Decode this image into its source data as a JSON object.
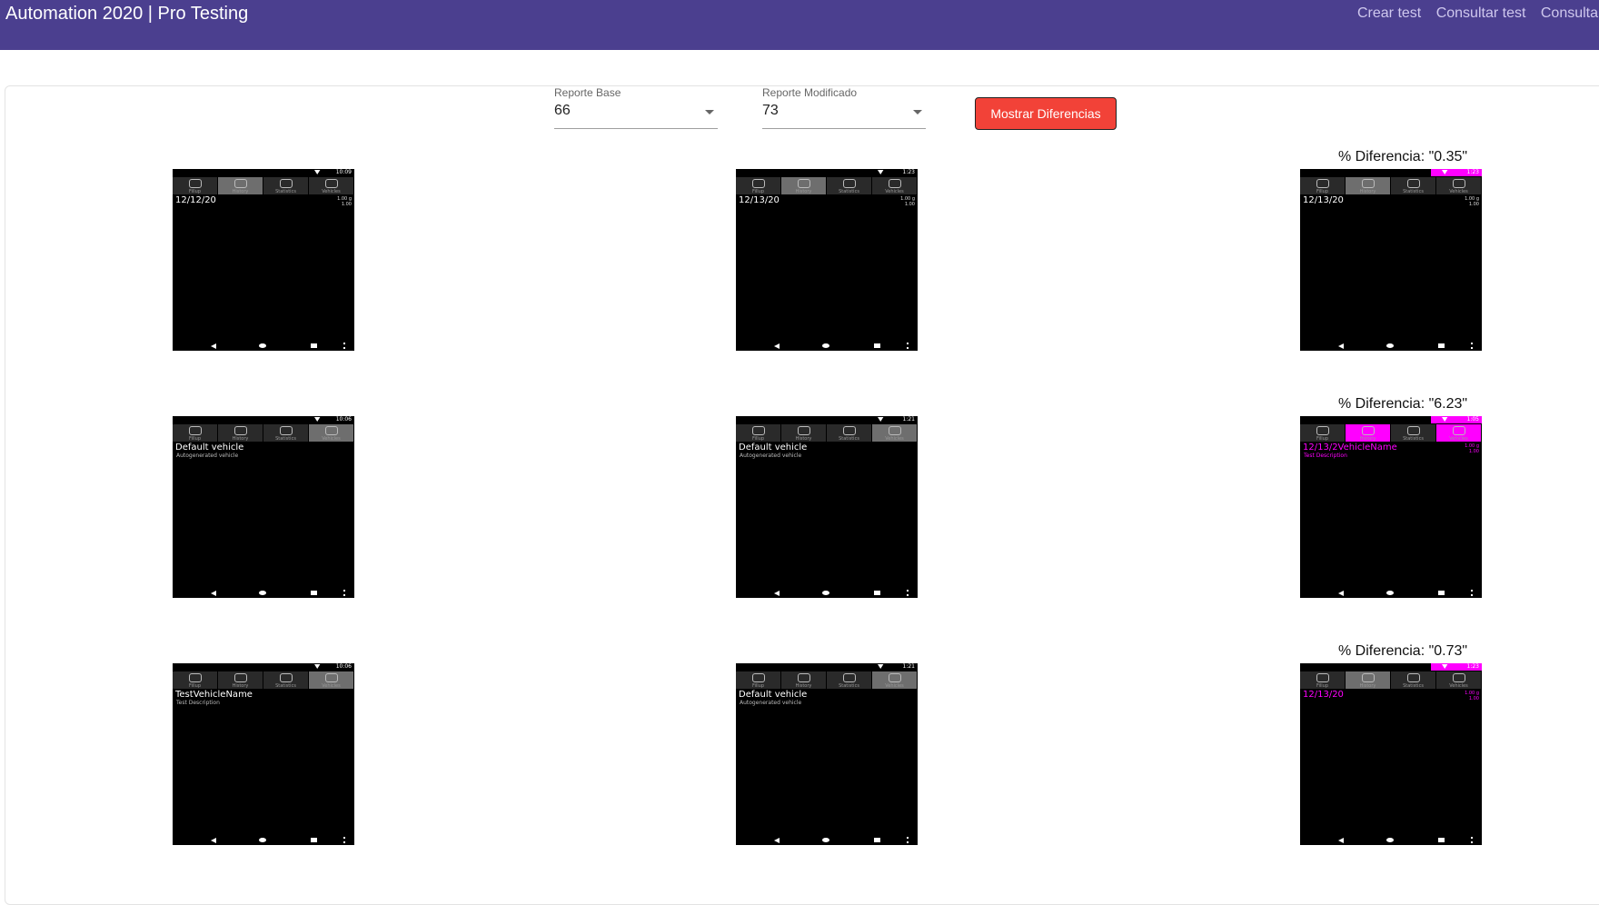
{
  "header": {
    "title": "Automation 2020 | Pro Testing",
    "nav": [
      "Crear test",
      "Consultar test",
      "Consulta"
    ]
  },
  "controls": {
    "base": {
      "label": "Reporte Base",
      "value": "66"
    },
    "modified": {
      "label": "Reporte Modificado",
      "value": "73"
    },
    "button_label": "Mostrar Diferencias"
  },
  "rows": [
    {
      "diff_label": "% Diferencia: \"0.35\"",
      "base": {
        "time": "10:09",
        "active_tab": "History",
        "line1": "12/12/20",
        "line2": "",
        "right": [
          "1.00 g",
          "1.00"
        ]
      },
      "modified": {
        "time": "1:23",
        "active_tab": "History",
        "line1": "12/13/20",
        "line2": "",
        "right": [
          "1.00 g",
          "1.00"
        ]
      },
      "diff": {
        "time": "1:23",
        "active_tab": "History",
        "line1": "12/13/20",
        "line2": "",
        "right": [
          "1.00 g",
          "1.00"
        ]
      }
    },
    {
      "diff_label": "% Diferencia: \"6.23\"",
      "base": {
        "time": "10:06",
        "active_tab": "Vehicles",
        "line1": "Default vehicle",
        "line2": "Autogenerated vehicle",
        "right": []
      },
      "modified": {
        "time": "1:21",
        "active_tab": "Vehicles",
        "line1": "Default vehicle",
        "line2": "Autogenerated vehicle",
        "right": []
      },
      "diff": {
        "time": "1:05",
        "active_tab": "",
        "line1": "12/13/2VehicleName",
        "line2": "Test Description",
        "right": [
          "1.00 g",
          "1.00"
        ]
      }
    },
    {
      "diff_label": "% Diferencia: \"0.73\"",
      "base": {
        "time": "10:06",
        "active_tab": "Vehicles",
        "line1": "TestVehicleName",
        "line2": "Test Description",
        "right": []
      },
      "modified": {
        "time": "1:21",
        "active_tab": "Vehicles",
        "line1": "Default vehicle",
        "line2": "Autogenerated vehicle",
        "right": []
      },
      "diff": {
        "time": "1:23",
        "active_tab": "History",
        "line1": "12/13/20",
        "line2": "",
        "right": [
          "1.00 g",
          "1.00"
        ]
      }
    }
  ],
  "tab_names": [
    "Fillup",
    "History",
    "Statistics",
    "Vehicles"
  ],
  "colors": {
    "header": "#4b3f8f",
    "button": "#f24238",
    "diff_highlight": "#ff00ff"
  }
}
